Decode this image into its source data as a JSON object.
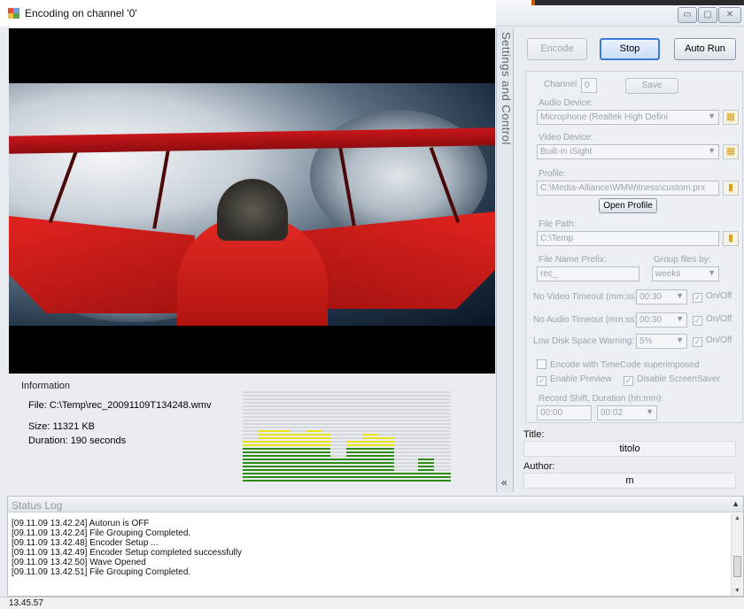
{
  "window": {
    "title": "Encoding on channel '0'",
    "controls": [
      "▭",
      "▢",
      "✕"
    ]
  },
  "info": {
    "group_title": "Information",
    "file": "File: C:\\Temp\\rec_20091109T134248.wmv",
    "size": "Size: 11321 KB",
    "duration": "Duration: 190 seconds"
  },
  "audio_meter": {
    "levels": [
      0.45,
      0.45,
      0.58,
      0.58,
      0.58,
      0.58,
      0.55,
      0.55,
      0.58,
      0.58,
      0.55,
      0.25,
      0.25,
      0.48,
      0.48,
      0.52,
      0.52,
      0.5,
      0.5,
      0.13,
      0.12,
      0.12,
      0.27,
      0.27,
      0.13,
      0.13
    ],
    "colors": {
      "low": "#2e8b14",
      "high": "#e8e21a",
      "empty": "#d6d8dc"
    }
  },
  "splitter": {
    "label": "Settings and Control",
    "collapse": "«"
  },
  "controls": {
    "encode": "Encode",
    "stop": "Stop",
    "auto_run": "Auto Run"
  },
  "settings": {
    "channel_label": "Channel",
    "channel_value": "0",
    "save": "Save",
    "audio_device_label": "Audio Device:",
    "audio_device_value": "Microphone (Realtek High Defini",
    "video_device_label": "Video Device:",
    "video_device_value": "Built-in iSight",
    "profile_label": "Profile:",
    "profile_value": "C:\\Media-Alliance\\WMWitness\\custom.prx",
    "open_profile": "Open Profile",
    "file_path_label": "File Path:",
    "file_path_value": "C:\\Temp",
    "prefix_label": "File Name Prefix:",
    "prefix_value": "rec_",
    "group_label": "Group files by:",
    "group_value": "weeks",
    "no_video_label": "No Video Timeout (mm:ss):",
    "no_video_value": "00:30",
    "no_audio_label": "No Audio Timeout (mm:ss):",
    "no_audio_value": "00:30",
    "low_disk_label": "Low Disk Space Warning:",
    "low_disk_value": "5%",
    "onoff": "On/Off",
    "timecode": "Encode with TimeCode superimposed",
    "enable_preview": "Enable Preview",
    "disable_screensaver": "Disable ScreenSaver",
    "record_shift_label": "Record Shift, Duration (hh:mm):",
    "record_shift_value": "00:00",
    "duration_value": "00:02"
  },
  "metadata": {
    "title_label": "Title:",
    "title_value": "titolo",
    "author_label": "Author:",
    "author_value": "m"
  },
  "status_log": {
    "title": "Status Log",
    "lines": [
      "[09.11.09 13.42.24] Autorun is OFF",
      "[09.11.09 13.42.24] File Grouping Completed.",
      "[09.11.09 13.42.48] Encoder Setup ...",
      "[09.11.09 13.42.49] Encoder Setup completed successfully",
      "[09.11.09 13.42.50] Wave Opened",
      "[09.11.09 13.42.51] File Grouping Completed."
    ]
  },
  "statusbar": {
    "time": "13.45.57"
  },
  "icons": {
    "app": "app-icon",
    "folder": "folder-icon",
    "device_settings": "device-settings-icon",
    "dropdown": "chevron-down-icon",
    "scroll_up": "scroll-up-icon",
    "scroll_down": "scroll-down-icon",
    "expand": "expand-icon"
  }
}
